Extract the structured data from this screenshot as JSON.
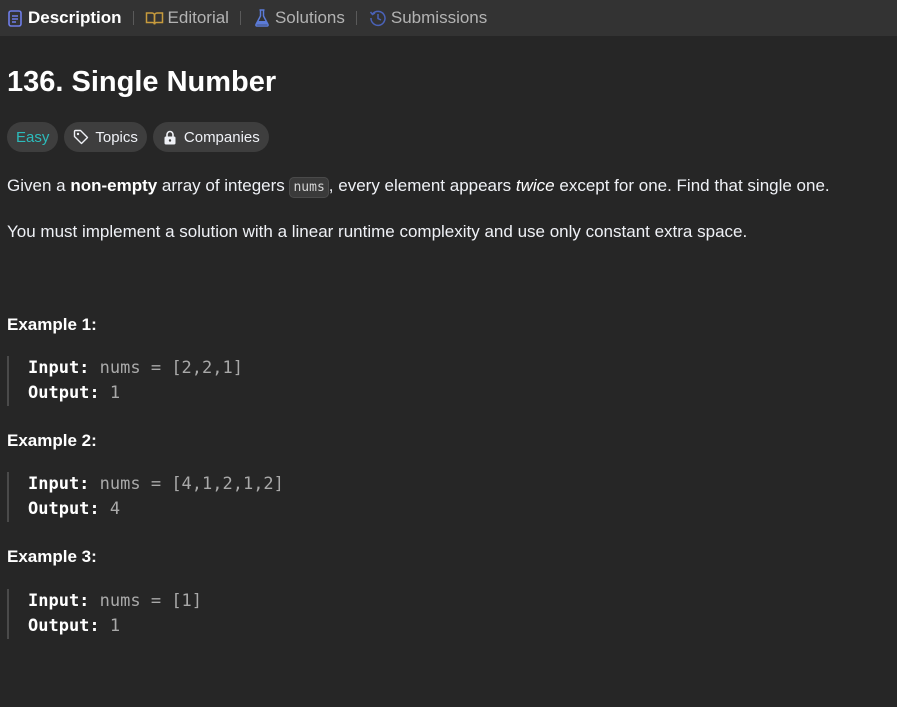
{
  "tabs": [
    {
      "label": "Description",
      "icon": "document-icon",
      "active": true
    },
    {
      "label": "Editorial",
      "icon": "book-icon",
      "active": false
    },
    {
      "label": "Solutions",
      "icon": "flask-icon",
      "active": false
    },
    {
      "label": "Submissions",
      "icon": "history-icon",
      "active": false
    }
  ],
  "problem": {
    "title": "136. Single Number",
    "difficulty": "Easy",
    "topics_label": "Topics",
    "companies_label": "Companies",
    "desc1": {
      "part1": "Given a ",
      "bold": "non-empty",
      "part2": " array of integers ",
      "code": "nums",
      "part3": ", every element appears ",
      "italic": "twice",
      "part4": " except for one. Find that single one."
    },
    "desc2": "You must implement a solution with a linear runtime complexity and use only constant extra space."
  },
  "examples": [
    {
      "title": "Example 1:",
      "input_label": "Input:",
      "input": "nums = [2,2,1]",
      "output_label": "Output:",
      "output": "1"
    },
    {
      "title": "Example 2:",
      "input_label": "Input:",
      "input": "nums = [4,1,2,1,2]",
      "output_label": "Output:",
      "output": "4"
    },
    {
      "title": "Example 3:",
      "input_label": "Input:",
      "input": "nums = [1]",
      "output_label": "Output:",
      "output": "1"
    }
  ],
  "colors": {
    "easy": "#2cbbbb",
    "background": "#262626",
    "tabbar": "#333333",
    "tab_icon_accent": "#5c6bc0",
    "editorial_icon": "#b38f3e"
  }
}
